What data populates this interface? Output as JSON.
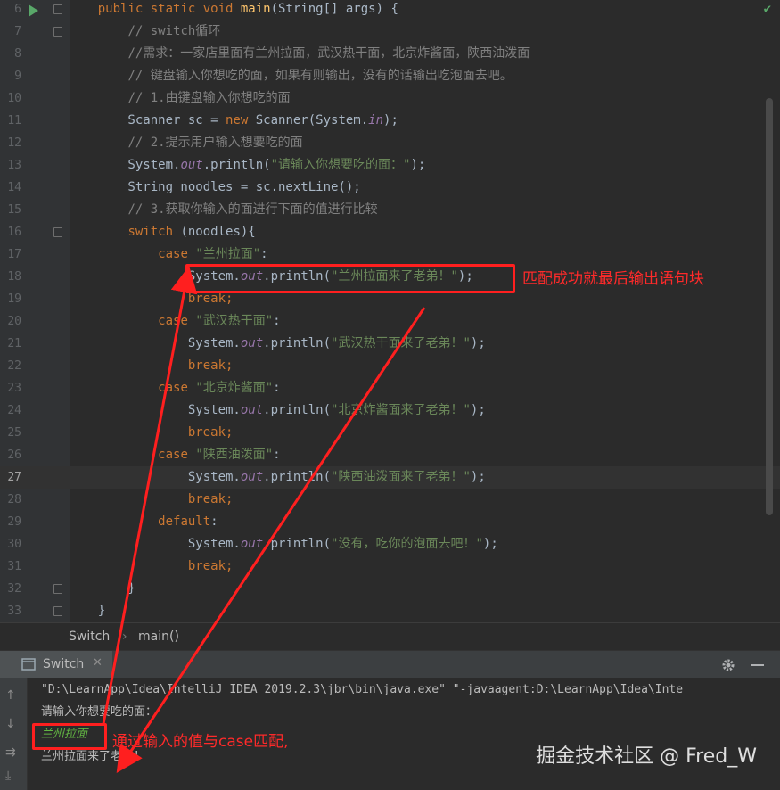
{
  "editor": {
    "lines": [
      {
        "n": "6",
        "tokens": [
          {
            "t": "    "
          },
          {
            "t": "public static void ",
            "c": "kw"
          },
          {
            "t": "main",
            "c": "fn"
          },
          {
            "t": "(String[] args) {"
          }
        ]
      },
      {
        "n": "7",
        "tokens": [
          {
            "t": "        "
          },
          {
            "t": "// switch循环",
            "c": "cm"
          }
        ]
      },
      {
        "n": "8",
        "tokens": [
          {
            "t": "        "
          },
          {
            "t": "//需求：一家店里面有兰州拉面，武汉热干面，北京炸酱面，陕西油泼面",
            "c": "cm"
          }
        ]
      },
      {
        "n": "9",
        "tokens": [
          {
            "t": "        "
          },
          {
            "t": "// 键盘输入你想吃的面，如果有则输出，没有的话输出吃泡面去吧。",
            "c": "cm"
          }
        ]
      },
      {
        "n": "10",
        "tokens": [
          {
            "t": "        "
          },
          {
            "t": "// 1.由键盘输入你想吃的面",
            "c": "cm"
          }
        ]
      },
      {
        "n": "11",
        "tokens": [
          {
            "t": "        Scanner sc = "
          },
          {
            "t": "new ",
            "c": "kw"
          },
          {
            "t": "Scanner(System."
          },
          {
            "t": "in",
            "c": "it"
          },
          {
            "t": ");"
          }
        ]
      },
      {
        "n": "12",
        "tokens": [
          {
            "t": "        "
          },
          {
            "t": "// 2.提示用户输入想要吃的面",
            "c": "cm"
          }
        ]
      },
      {
        "n": "13",
        "tokens": [
          {
            "t": "        System."
          },
          {
            "t": "out",
            "c": "it"
          },
          {
            "t": ".println("
          },
          {
            "t": "\"请输入你想要吃的面：\"",
            "c": "str"
          },
          {
            "t": ");"
          }
        ]
      },
      {
        "n": "14",
        "tokens": [
          {
            "t": "        String noodles = sc.nextLine();"
          }
        ]
      },
      {
        "n": "15",
        "tokens": [
          {
            "t": "        "
          },
          {
            "t": "// 3.获取你输入的面进行下面的值进行比较",
            "c": "cm"
          }
        ]
      },
      {
        "n": "16",
        "tokens": [
          {
            "t": "        "
          },
          {
            "t": "switch ",
            "c": "kw"
          },
          {
            "t": "(noodles){"
          }
        ]
      },
      {
        "n": "17",
        "tokens": [
          {
            "t": "            "
          },
          {
            "t": "case ",
            "c": "kw"
          },
          {
            "t": "\"兰州拉面\"",
            "c": "str"
          },
          {
            "t": ":"
          }
        ]
      },
      {
        "n": "18",
        "tokens": [
          {
            "t": "                System."
          },
          {
            "t": "out",
            "c": "it"
          },
          {
            "t": ".println("
          },
          {
            "t": "\"兰州拉面来了老弟！\"",
            "c": "str"
          },
          {
            "t": ");"
          }
        ]
      },
      {
        "n": "19",
        "tokens": [
          {
            "t": "                "
          },
          {
            "t": "break;",
            "c": "kw"
          }
        ]
      },
      {
        "n": "20",
        "tokens": [
          {
            "t": "            "
          },
          {
            "t": "case ",
            "c": "kw"
          },
          {
            "t": "\"武汉热干面\"",
            "c": "str"
          },
          {
            "t": ":"
          }
        ]
      },
      {
        "n": "21",
        "tokens": [
          {
            "t": "                System."
          },
          {
            "t": "out",
            "c": "it"
          },
          {
            "t": ".println("
          },
          {
            "t": "\"武汉热干面来了老弟！\"",
            "c": "str"
          },
          {
            "t": ");"
          }
        ]
      },
      {
        "n": "22",
        "tokens": [
          {
            "t": "                "
          },
          {
            "t": "break;",
            "c": "kw"
          }
        ]
      },
      {
        "n": "23",
        "tokens": [
          {
            "t": "            "
          },
          {
            "t": "case ",
            "c": "kw"
          },
          {
            "t": "\"北京炸酱面\"",
            "c": "str"
          },
          {
            "t": ":"
          }
        ]
      },
      {
        "n": "24",
        "tokens": [
          {
            "t": "                System."
          },
          {
            "t": "out",
            "c": "it"
          },
          {
            "t": ".println("
          },
          {
            "t": "\"北京炸酱面来了老弟！\"",
            "c": "str"
          },
          {
            "t": ");"
          }
        ]
      },
      {
        "n": "25",
        "tokens": [
          {
            "t": "                "
          },
          {
            "t": "break;",
            "c": "kw"
          }
        ]
      },
      {
        "n": "26",
        "tokens": [
          {
            "t": "            "
          },
          {
            "t": "case ",
            "c": "kw"
          },
          {
            "t": "\"陕西油泼面\"",
            "c": "str"
          },
          {
            "t": ":"
          }
        ]
      },
      {
        "n": "27",
        "tokens": [
          {
            "t": "                System."
          },
          {
            "t": "out",
            "c": "it"
          },
          {
            "t": ".println("
          },
          {
            "t": "\"陕西油泼面来了老弟！\"",
            "c": "str"
          },
          {
            "t": ");"
          }
        ]
      },
      {
        "n": "28",
        "tokens": [
          {
            "t": "                "
          },
          {
            "t": "break;",
            "c": "kw"
          }
        ]
      },
      {
        "n": "29",
        "tokens": [
          {
            "t": "            "
          },
          {
            "t": "default",
            "c": "kw"
          },
          {
            "t": ":"
          }
        ]
      },
      {
        "n": "30",
        "tokens": [
          {
            "t": "                System."
          },
          {
            "t": "out",
            "c": "it"
          },
          {
            "t": ".println("
          },
          {
            "t": "\"没有，吃你的泡面去吧！\"",
            "c": "str"
          },
          {
            "t": ");"
          }
        ]
      },
      {
        "n": "31",
        "tokens": [
          {
            "t": "                "
          },
          {
            "t": "break;",
            "c": "kw"
          }
        ]
      },
      {
        "n": "32",
        "tokens": [
          {
            "t": "        }"
          }
        ]
      },
      {
        "n": "33",
        "tokens": [
          {
            "t": "    }"
          }
        ]
      }
    ],
    "current_line": "27"
  },
  "breadcrumb": {
    "class_name": "Switch",
    "separator": "›",
    "method_name": "main()"
  },
  "run_panel": {
    "tab_label": "Switch"
  },
  "console": {
    "command": "\"D:\\LearnApp\\Idea\\IntelliJ IDEA 2019.2.3\\jbr\\bin\\java.exe\" \"-javaagent:D:\\LearnApp\\Idea\\Inte",
    "prompt": "请输入你想要吃的面：",
    "user_input": "兰州拉面",
    "output": "兰州拉面来了老弟！"
  },
  "annotations": {
    "match_note": "匹配成功就最后输出语句块",
    "input_note": "通过输入的值与case匹配,"
  },
  "watermark": "掘金技术社区 @ Fred_W",
  "colors": {
    "annotation": "#ff1f1f",
    "keyword": "#cc7832",
    "string": "#6a8759",
    "comment": "#808080"
  }
}
